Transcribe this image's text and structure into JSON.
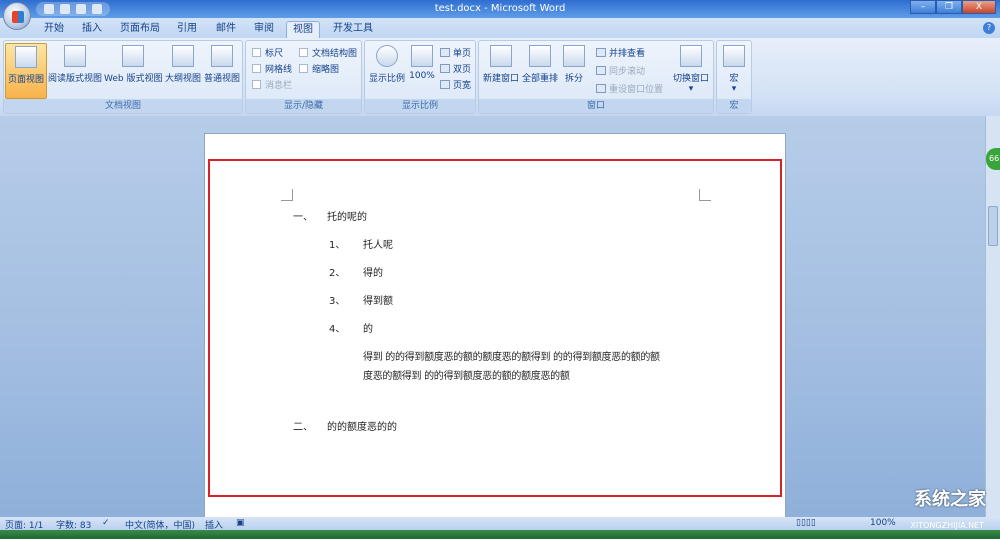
{
  "window": {
    "title": "test.docx - Microsoft Word",
    "minimize": "–",
    "restore": "❐",
    "close": "X",
    "help": "?"
  },
  "tabs": [
    "开始",
    "插入",
    "页面布局",
    "引用",
    "邮件",
    "审阅",
    "视图",
    "开发工具"
  ],
  "active_tab": "视图",
  "ribbon": {
    "doc_views": {
      "label": "文档视图",
      "buttons": [
        "页面视图",
        "阅读版式视图",
        "Web 版式视图",
        "大纲视图",
        "普通视图"
      ],
      "selected": "页面视图"
    },
    "show_hide": {
      "label": "显示/隐藏",
      "checkboxes": [
        {
          "label": "标尺",
          "checked": false
        },
        {
          "label": "文档结构图",
          "checked": false
        },
        {
          "label": "网格线",
          "checked": false
        },
        {
          "label": "缩略图",
          "checked": false
        },
        {
          "label": "消息栏",
          "checked": false,
          "disabled": true
        }
      ]
    },
    "zoom": {
      "label": "显示比例",
      "buttons": [
        "显示比例",
        "100%"
      ],
      "small": [
        "单页",
        "双页",
        "页宽"
      ]
    },
    "window": {
      "label": "窗口",
      "buttons": [
        "新建窗口",
        "全部重排",
        "拆分"
      ],
      "small": [
        "并排查看",
        "同步滚动",
        "重设窗口位置"
      ],
      "switch": "切换窗口"
    },
    "macro": {
      "label": "宏",
      "button": "宏"
    }
  },
  "document": {
    "h1": {
      "num": "一、",
      "text": "托的呢的"
    },
    "items": [
      {
        "num": "1、",
        "text": "托人呢"
      },
      {
        "num": "2、",
        "text": "得的"
      },
      {
        "num": "3、",
        "text": "得到额"
      },
      {
        "num": "4、",
        "text": "的"
      }
    ],
    "para": [
      "得到 的的得到额度恶的额的额度恶的额得到 的的得到额度恶的额的额",
      "度恶的额得到 的的得到额度恶的额的额度恶的额"
    ],
    "h2": {
      "num": "二、",
      "text": "的的额度恶的的"
    }
  },
  "status": {
    "page": "页面: 1/1",
    "words": "字数: 83",
    "lang": "中文(简体，中国)",
    "mode": "插入",
    "zoom": "100%"
  },
  "side_badge": "66",
  "watermark": {
    "text": "系统之家",
    "sub": "XITONGZHIJIA.NET"
  }
}
